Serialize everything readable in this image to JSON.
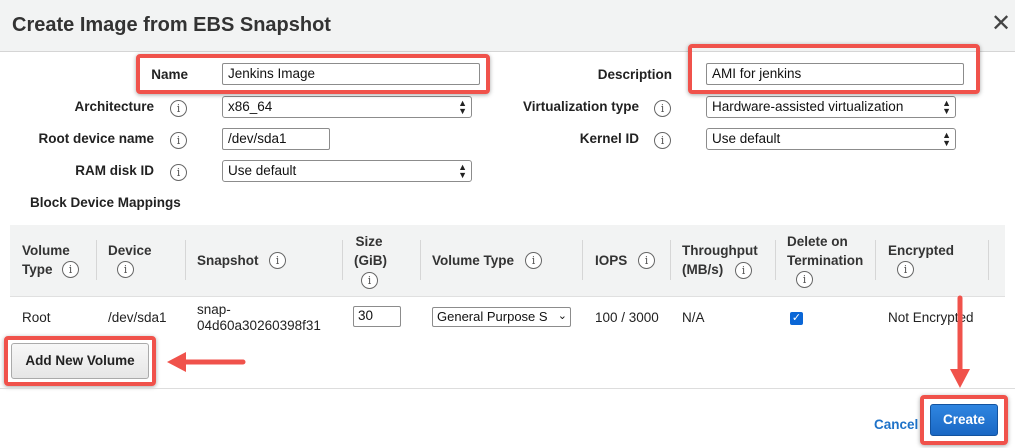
{
  "dialog": {
    "title": "Create Image from EBS Snapshot",
    "close_glyph": "✕"
  },
  "form": {
    "name": {
      "label": "Name",
      "value": "Jenkins Image"
    },
    "description": {
      "label": "Description",
      "value": "AMI for jenkins"
    },
    "architecture": {
      "label": "Architecture",
      "value": "x86_64"
    },
    "virtualization": {
      "label": "Virtualization type",
      "value": "Hardware-assisted virtualization"
    },
    "root_device": {
      "label": "Root device name",
      "value": "/dev/sda1"
    },
    "kernel": {
      "label": "Kernel ID",
      "value": "Use default"
    },
    "ramdisk": {
      "label": "RAM disk ID",
      "value": "Use default"
    }
  },
  "block_mappings": {
    "title": "Block Device Mappings",
    "headers": {
      "volume_type_l1": "Volume",
      "volume_type_l2": "Type",
      "device": "Device",
      "snapshot": "Snapshot",
      "size_l1": "Size",
      "size_l2": "(GiB)",
      "vol_type": "Volume Type",
      "iops": "IOPS",
      "throughput_l1": "Throughput",
      "throughput_l2": "(MB/s)",
      "delete_l1": "Delete on",
      "delete_l2": "Termination",
      "encrypted": "Encrypted"
    },
    "row": {
      "volume_type": "Root",
      "device": "/dev/sda1",
      "snapshot_l1": "snap-",
      "snapshot_l2": "04d60a30260398f31",
      "size": "30",
      "vol_type": "General Purpose S",
      "iops": "100 / 3000",
      "throughput": "N/A",
      "delete_on_termination": true,
      "encrypted": "Not Encrypted"
    }
  },
  "buttons": {
    "add_volume": "Add New Volume",
    "cancel": "Cancel",
    "create": "Create"
  },
  "icons": {
    "info": "i",
    "select_arrow": "▲▼",
    "check": "✓"
  },
  "colors": {
    "highlight": "#f0524b",
    "primary": "#1a68c4",
    "link": "#1e72c8"
  }
}
